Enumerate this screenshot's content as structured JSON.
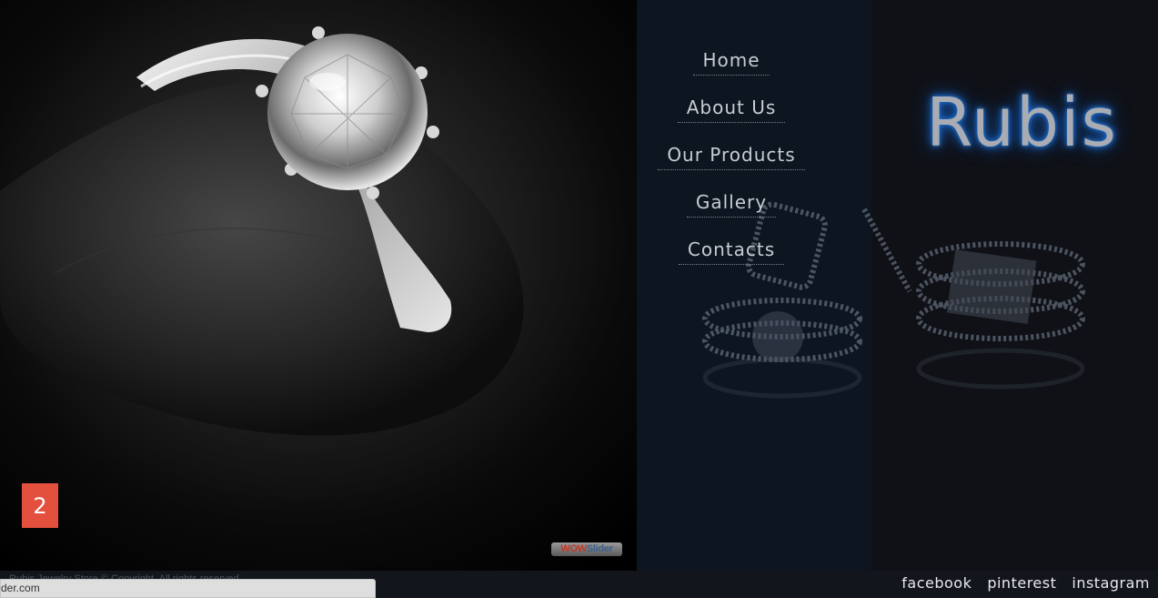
{
  "slider": {
    "slide_number": "2",
    "badge": {
      "part1": "WOW",
      "part2": "Slider"
    }
  },
  "nav": {
    "items": [
      {
        "label": "Home"
      },
      {
        "label": "About Us"
      },
      {
        "label": "Our Products"
      },
      {
        "label": "Gallery"
      },
      {
        "label": "Contacts"
      }
    ]
  },
  "brand": {
    "name": "Rubis"
  },
  "footer": {
    "copyright": "Rubis Jewelry Store © Copyright. All rights reserved.",
    "socials": [
      {
        "label": "facebook",
        "icon": "facebook-link"
      },
      {
        "label": "pinterest",
        "icon": "pinterest-link"
      },
      {
        "label": "instagram",
        "icon": "instagram-link"
      }
    ]
  },
  "status_bar": {
    "url": "der.com"
  },
  "colors": {
    "slide_number_bg": "#e3513e",
    "nav_panel_bg": "#0d1520",
    "brand_glow": "#1b6fd8"
  }
}
